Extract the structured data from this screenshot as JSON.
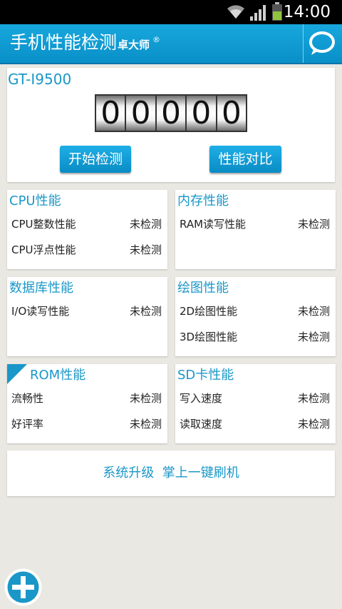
{
  "status_bar": {
    "time": "14:00",
    "icons": [
      "wifi-icon",
      "signal-icon",
      "battery-icon"
    ]
  },
  "app_bar": {
    "title": "手机性能检测",
    "brand": "卓大师",
    "reg_mark": "®",
    "chat_icon": "chat-bubble-icon"
  },
  "device": {
    "model": "GT-I9500",
    "score_digits": [
      "0",
      "0",
      "0",
      "0",
      "0"
    ]
  },
  "buttons": {
    "start": "开始检测",
    "compare": "性能对比"
  },
  "cards": {
    "cpu": {
      "title": "CPU性能",
      "rows": [
        {
          "label": "CPU整数性能",
          "value": "未检测"
        },
        {
          "label": "CPU浮点性能",
          "value": "未检测"
        }
      ]
    },
    "memory": {
      "title": "内存性能",
      "rows": [
        {
          "label": "RAM读写性能",
          "value": "未检测"
        }
      ]
    },
    "database": {
      "title": "数据库性能",
      "rows": [
        {
          "label": "I/O读写性能",
          "value": "未检测"
        }
      ]
    },
    "graphics": {
      "title": "绘图性能",
      "rows": [
        {
          "label": "2D绘图性能",
          "value": "未检测"
        },
        {
          "label": "3D绘图性能",
          "value": "未检测"
        }
      ]
    },
    "rom": {
      "title": "ROM性能",
      "rows": [
        {
          "label": "流畅性",
          "value": "未检测"
        },
        {
          "label": "好评率",
          "value": "未检测"
        }
      ]
    },
    "sd": {
      "title": "SD卡性能",
      "rows": [
        {
          "label": "写入速度",
          "value": "未检测"
        },
        {
          "label": "读取速度",
          "value": "未检测"
        }
      ]
    }
  },
  "upgrade": {
    "text": "系统升级  掌上一键刷机"
  },
  "fab_icon": "plus-icon",
  "colors": {
    "accent": "#1a97c8",
    "app_bar": "#0a8fc8",
    "background": "#e9e8e2"
  }
}
